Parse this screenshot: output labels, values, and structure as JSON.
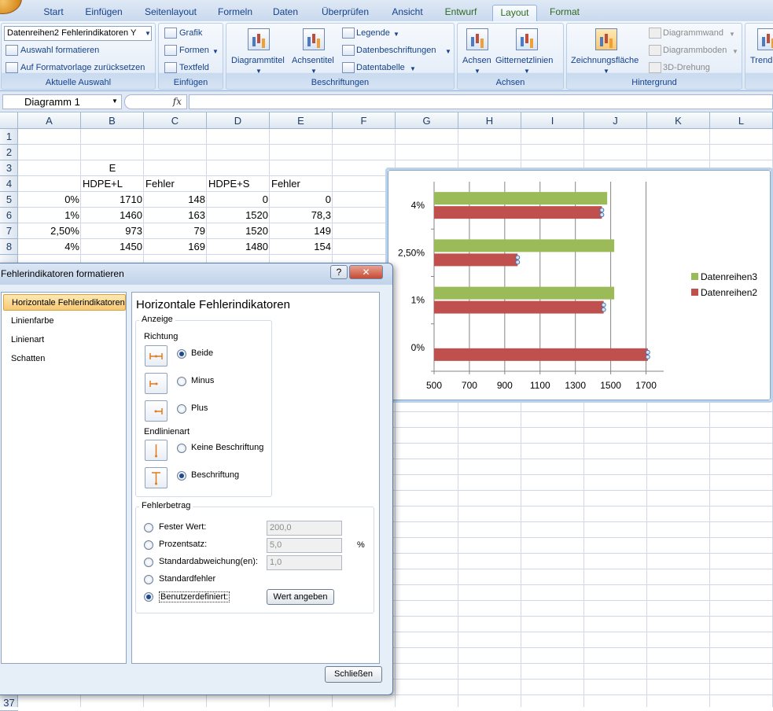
{
  "ribbon": {
    "tabs": [
      "Start",
      "Einfügen",
      "Seitenlayout",
      "Formeln",
      "Daten",
      "Überprüfen",
      "Ansicht",
      "Entwurf",
      "Layout",
      "Format"
    ],
    "groups": {
      "auswahl": {
        "dropdown": "Datenreihen2 Fehlerindikatoren Y",
        "format_sel": "Auswahl formatieren",
        "reset": "Auf Formatvorlage zurücksetzen",
        "label": "Aktuelle Auswahl"
      },
      "einfuegen": {
        "grafik": "Grafik",
        "formen": "Formen",
        "textfeld": "Textfeld",
        "label": "Einfügen"
      },
      "beschriftungen": {
        "diagrammtitel": "Diagrammtitel",
        "achsentitel": "Achsentitel",
        "legende": "Legende",
        "datenbeschriftungen": "Datenbeschriftungen",
        "datentabelle": "Datentabelle",
        "label": "Beschriftungen"
      },
      "achsen": {
        "achsen": "Achsen",
        "gitternetz": "Gitternetzlinien",
        "label": "Achsen"
      },
      "hintergrund": {
        "zeichnungsflaeche": "Zeichnungsfläche",
        "diagrammwand": "Diagrammwand",
        "diagrammboden": "Diagrammboden",
        "drehung": "3D-Drehung",
        "label": "Hintergrund"
      },
      "analyse": {
        "trend": "Trend"
      }
    }
  },
  "formula": {
    "namebox": "Diagramm 1",
    "fx": "fx"
  },
  "columns": [
    "A",
    "B",
    "C",
    "D",
    "E",
    "F",
    "G",
    "H",
    "I",
    "J",
    "K",
    "L"
  ],
  "rows": [
    "1",
    "2",
    "3",
    "4",
    "5",
    "6",
    "7",
    "8"
  ],
  "last_row": "37",
  "sheet": {
    "title": "E",
    "headers": [
      "HDPE+L",
      "Fehler",
      "HDPE+S",
      "Fehler"
    ],
    "data": [
      [
        "0%",
        "1710",
        "148",
        "0",
        "0"
      ],
      [
        "1%",
        "1460",
        "163",
        "1520",
        "78,3"
      ],
      [
        "2,50%",
        "973",
        "79",
        "1520",
        "149"
      ],
      [
        "4%",
        "1450",
        "169",
        "1480",
        "154"
      ]
    ]
  },
  "chart_data": {
    "type": "bar",
    "orientation": "horizontal",
    "categories": [
      "0%",
      "1%",
      "2,50%",
      "4%"
    ],
    "series": [
      {
        "name": "Datenreihen3",
        "color": "#9bbb59",
        "values": [
          null,
          1520,
          1520,
          1480
        ]
      },
      {
        "name": "Datenreihen2",
        "color": "#c0504d",
        "values": [
          1710,
          1460,
          973,
          1450
        ]
      }
    ],
    "x_ticks": [
      "500",
      "700",
      "900",
      "1100",
      "1300",
      "1500",
      "1700"
    ],
    "xlim": [
      500,
      1800
    ],
    "grid": "vertical",
    "legend": "right"
  },
  "dialog": {
    "title": "Fehlerindikatoren formatieren",
    "help": "?",
    "close": "✕",
    "nav": [
      "Horizontale Fehlerindikatoren",
      "Linienfarbe",
      "Linienart",
      "Schatten"
    ],
    "heading": "Horizontale Fehlerindikatoren",
    "anzeige": "Anzeige",
    "richtung": "Richtung",
    "beide": "Beide",
    "minus": "Minus",
    "plus": "Plus",
    "endlinienart": "Endlinienart",
    "keine": "Keine Beschriftung",
    "beschriftung": "Beschriftung",
    "fehlerbetrag": "Fehlerbetrag",
    "fester_wert": "Fester Wert:",
    "fester_val": "200,0",
    "prozentsatz": "Prozentsatz:",
    "prozent_val": "5,0",
    "prozent_unit": "%",
    "stdabw": "Standardabweichung(en):",
    "stdabw_val": "1,0",
    "stdfehler": "Standardfehler",
    "benutzer": "Benutzerdefiniert:",
    "wert": "Wert angeben",
    "schliessen": "Schließen"
  }
}
